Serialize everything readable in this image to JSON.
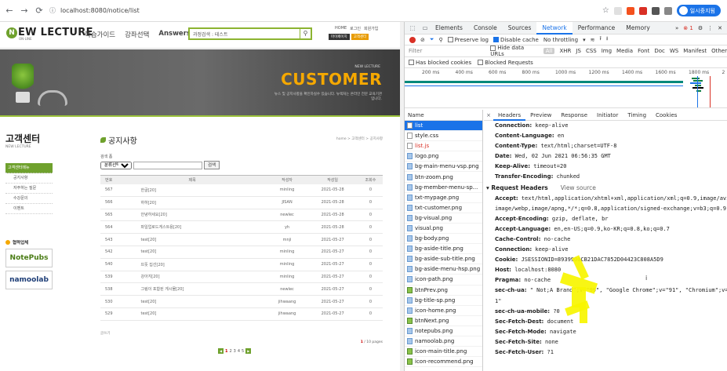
{
  "browser": {
    "url": "localhost:8080/notice/list",
    "profile": "일시중지됨"
  },
  "site": {
    "logo": {
      "letter": "N",
      "text": "EW LECTURE",
      "sub": "ON-LINE"
    },
    "menu": [
      "학습가이드",
      "강좌선택",
      "Answers"
    ],
    "search_placeholder": "과정검색 : 테스트",
    "toplinks": [
      "HOME",
      "로그인",
      "회원가입"
    ],
    "mypage": [
      "마이페이지",
      "고객센터"
    ],
    "banner": {
      "small": "NEW LECTURE",
      "title": "CUSTOMER",
      "desc": "뉴스 및 공지사항을 확인하실수 있습니다. 뉴렉처는 온라인 전문 교육기관입니다."
    },
    "sidebar": {
      "title": "고객센터",
      "sub": "NEW LECTURE",
      "items": [
        {
          "label": "고객센터메뉴",
          "type": "active"
        },
        {
          "label": "공지사항",
          "type": "sub"
        },
        {
          "label": "자주하는 질문",
          "type": "sub"
        },
        {
          "label": "수강문의",
          "type": "sub"
        },
        {
          "label": "이벤트",
          "type": "sub"
        }
      ],
      "partners_title": "협력업체",
      "partners": [
        "NotePubs",
        "namoolab"
      ]
    },
    "content": {
      "title": "공지사항",
      "breadcrumb": "home > 고객센터 > 공지사항",
      "search_label": "검색 폼",
      "search_select": "분류선택",
      "search_btn": "검색",
      "columns": [
        "번호",
        "제목",
        "작성자",
        "작성일",
        "조회수"
      ],
      "rows": [
        [
          "567",
          "한글[20]",
          "minling",
          "2021-05-28",
          "0"
        ],
        [
          "566",
          "하하[20]",
          "JISAN",
          "2021-05-28",
          "0"
        ],
        [
          "565",
          "안녕하세요[20]",
          "newlec",
          "2021-05-28",
          "0"
        ],
        [
          "564",
          "파일업로드게스트용[20]",
          "yh",
          "2021-05-28",
          "0"
        ],
        [
          "543",
          "test[20]",
          "mnji",
          "2021-05-27",
          "0"
        ],
        [
          "542",
          "test[20]",
          "minling",
          "2021-05-27",
          "0"
        ],
        [
          "540",
          "뜨뜻 집선[20]",
          "minling",
          "2021-05-27",
          "0"
        ],
        [
          "539",
          "강아지[20]",
          "minling",
          "2021-05-27",
          "0"
        ],
        [
          "538",
          "그림이 포함된 게시물[20]",
          "newlec",
          "2021-05-27",
          "0"
        ],
        [
          "530",
          "test[20]",
          "jihwaang",
          "2021-05-27",
          "0"
        ],
        [
          "529",
          "test[20]",
          "jihwaang",
          "2021-05-27",
          "0"
        ]
      ],
      "list_footer": "글쓰기",
      "page_info_cur": "1",
      "page_info_rest": " / 10 pages",
      "pages": [
        "1",
        "2",
        "3",
        "4",
        "5"
      ]
    }
  },
  "devtools": {
    "tabs": [
      "Elements",
      "Console",
      "Sources",
      "Network",
      "Performance",
      "Memory"
    ],
    "active_tab": "Network",
    "error_count": "1",
    "toolbar": {
      "preserve": "Preserve log",
      "disable": "Disable cache",
      "throttle": "No throttling"
    },
    "filter": {
      "placeholder": "Filter",
      "hide": "Hide data URLs",
      "types": [
        "All",
        "XHR",
        "JS",
        "CSS",
        "Img",
        "Media",
        "Font",
        "Doc",
        "WS",
        "Manifest",
        "Other"
      ]
    },
    "block": {
      "cookies": "Has blocked cookies",
      "requests": "Blocked Requests"
    },
    "timeline_labels": [
      "200 ms",
      "400 ms",
      "600 ms",
      "800 ms",
      "1000 ms",
      "1200 ms",
      "1400 ms",
      "1600 ms",
      "1800 ms",
      "2"
    ],
    "name_header": "Name",
    "files": [
      {
        "n": "list",
        "t": "doc",
        "sel": true
      },
      {
        "n": "style.css",
        "t": "doc"
      },
      {
        "n": "list.js",
        "t": "doc",
        "red": true
      },
      {
        "n": "logo.png",
        "t": "img"
      },
      {
        "n": "bg-main-menu-vsp.png",
        "t": "img"
      },
      {
        "n": "btn-zoom.png",
        "t": "img"
      },
      {
        "n": "bg-member-menu-sp...",
        "t": "img"
      },
      {
        "n": "txt-mypage.png",
        "t": "img"
      },
      {
        "n": "txt-customer.png",
        "t": "img"
      },
      {
        "n": "bg-visual.png",
        "t": "img"
      },
      {
        "n": "visual.png",
        "t": "img"
      },
      {
        "n": "bg-body.png",
        "t": "img"
      },
      {
        "n": "bg-aside-title.png",
        "t": "img"
      },
      {
        "n": "bg-aside-sub-title.png",
        "t": "img"
      },
      {
        "n": "bg-aside-menu-hsp.png",
        "t": "img"
      },
      {
        "n": "icon-path.png",
        "t": "img"
      },
      {
        "n": "btnPrev.png",
        "t": "g"
      },
      {
        "n": "bg-title-sp.png",
        "t": "img"
      },
      {
        "n": "icon-home.png",
        "t": "img"
      },
      {
        "n": "btnNext.png",
        "t": "g"
      },
      {
        "n": "notepubs.png",
        "t": "img"
      },
      {
        "n": "namoolab.png",
        "t": "img"
      },
      {
        "n": "icon-main-title.png",
        "t": "g"
      },
      {
        "n": "icon-recommend.png",
        "t": "g"
      }
    ],
    "detail_tabs": [
      "Headers",
      "Preview",
      "Response",
      "Initiator",
      "Timing",
      "Cookies"
    ],
    "response_headers": [
      [
        "Connection:",
        "keep-alive"
      ],
      [
        "Content-Language:",
        "en"
      ],
      [
        "Content-Type:",
        "text/html;charset=UTF-8"
      ],
      [
        "Date:",
        "Wed, 02 Jun 2021 06:56:35 GMT"
      ],
      [
        "Keep-Alive:",
        "timeout=20"
      ],
      [
        "Transfer-Encoding:",
        "chunked"
      ]
    ],
    "request_title": "Request Headers",
    "view_source": "View source",
    "request_headers": [
      [
        "Accept:",
        "text/html,application/xhtml+xml,application/xml;q=0.9,image/avif,"
      ],
      [
        "",
        "image/webp,image/apng,*/*;q=0.8,application/signed-exchange;v=b3;q=0.9"
      ],
      [
        "Accept-Encoding:",
        "gzip, deflate, br"
      ],
      [
        "Accept-Language:",
        "en,en-US;q=0.9,ko-KR;q=0.8,ko;q=0.7"
      ],
      [
        "Cache-Control:",
        "no-cache"
      ],
      [
        "Connection:",
        "keep-alive"
      ],
      [
        "Cookie:",
        "JSESSIONID=8939900CB21DAC7852D04423C808A5D9"
      ],
      [
        "Host:",
        "localhost:8080"
      ],
      [
        "Pragma:",
        "no-cache"
      ],
      [
        "sec-ch-ua:",
        "\" Not;A Brand\";v=\"99\", \"Google Chrome\";v=\"91\", \"Chromium\";v=\"9"
      ],
      [
        "",
        "1\""
      ],
      [
        "sec-ch-ua-mobile:",
        "?0"
      ],
      [
        "Sec-Fetch-Dest:",
        "document"
      ],
      [
        "Sec-Fetch-Mode:",
        "navigate"
      ],
      [
        "Sec-Fetch-Site:",
        "none"
      ],
      [
        "Sec-Fetch-User:",
        "?1"
      ]
    ]
  }
}
